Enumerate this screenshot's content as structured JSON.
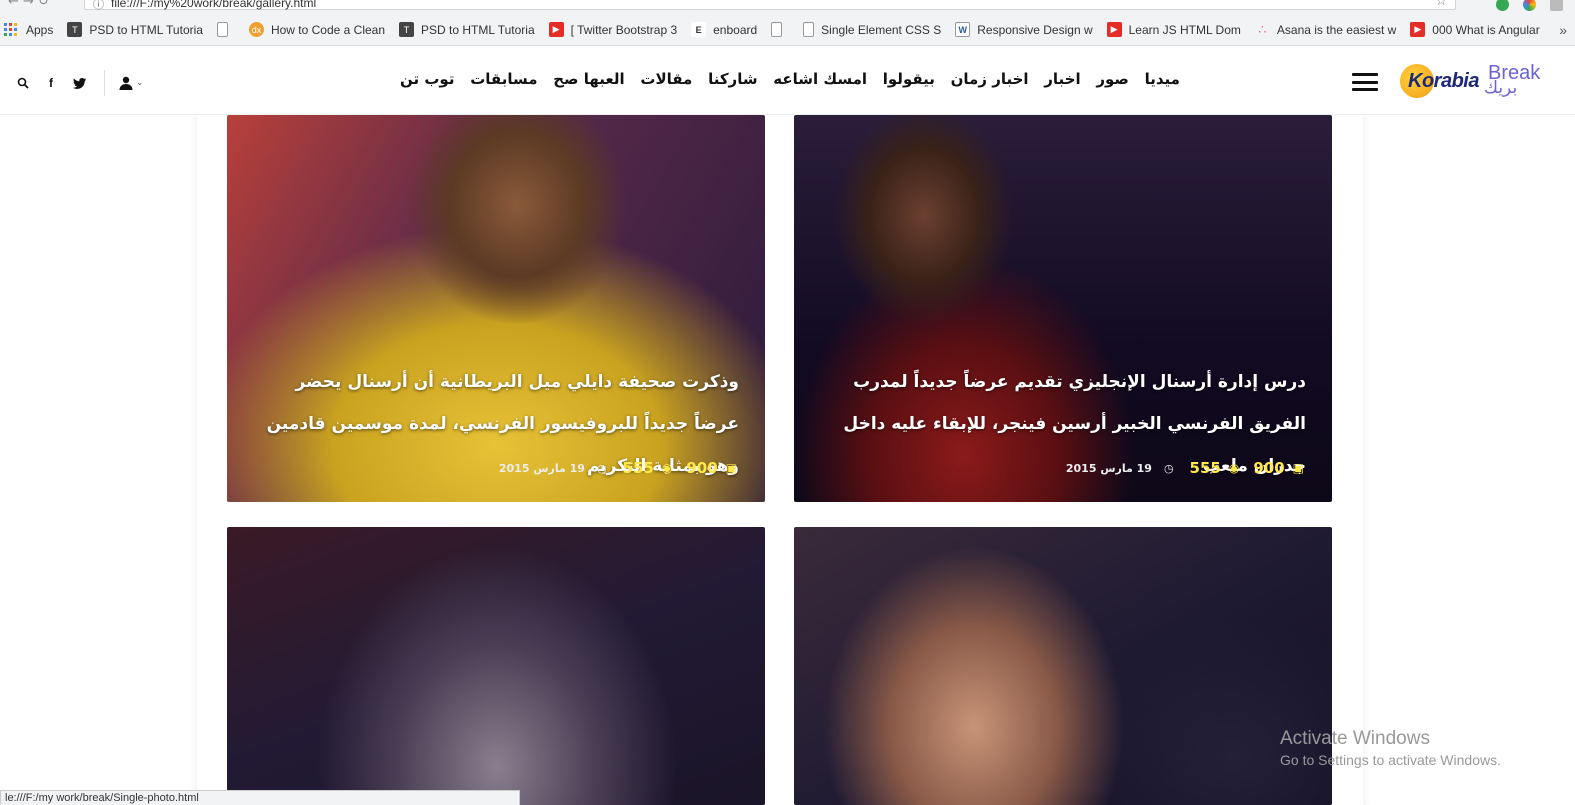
{
  "browser": {
    "url": "file:///F:/my%20work/break/gallery.html",
    "status_url": "le:///F:/my work/break/Single-photo.html",
    "bookmarks": [
      {
        "label": "Apps",
        "icon": "apps-grid-icon",
        "color": "#4285f4"
      },
      {
        "label": "PSD to HTML Tutoria",
        "icon": "tuts-icon",
        "color": "#333333"
      },
      {
        "label": "",
        "icon": "page-icon",
        "color": "#ffffff"
      },
      {
        "label": "How to Code a Clean",
        "icon": "dx-icon",
        "color": "#f0a030"
      },
      {
        "label": "PSD to HTML Tutoria",
        "icon": "tuts-icon",
        "color": "#333333"
      },
      {
        "label": "[ Twitter Bootstrap 3",
        "icon": "youtube-icon",
        "color": "#e52d27"
      },
      {
        "label": "enboard",
        "icon": "e-icon",
        "color": "#555555"
      },
      {
        "label": "",
        "icon": "page-icon",
        "color": "#ffffff"
      },
      {
        "label": "Single Element CSS S",
        "icon": "page-icon",
        "color": "#ffffff"
      },
      {
        "label": "Responsive Design w",
        "icon": "w-icon",
        "color": "#2b579a"
      },
      {
        "label": "Learn JS HTML Dom",
        "icon": "youtube-icon",
        "color": "#e52d27"
      },
      {
        "label": "Asana is the easiest w",
        "icon": "asana-icon",
        "color": "#f06a6a"
      },
      {
        "label": "000 What is Angular",
        "icon": "youtube-icon",
        "color": "#e52d27"
      }
    ]
  },
  "header": {
    "logo_text": "Korabia",
    "logo_break": "Break",
    "logo_arabic": "بريك",
    "nav": [
      "ميديا",
      "صور",
      "اخبار",
      "اخبار زمان",
      "بيقولوا",
      "امسك اشاعه",
      "شاركنا",
      "مقالات",
      "العبها صح",
      "مسابقات",
      "توب تن"
    ],
    "icons": [
      "search-icon",
      "facebook-icon",
      "twitter-icon",
      "user-icon"
    ]
  },
  "cards": [
    {
      "title": "درس إدارة أرسنال الإنجليزي تقديم عرضاً جديداً لمدرب الفريق الفرنسي الخبير أرسين فينجر، للإبقاء عليه داخل جدران ملعب",
      "photos": "900",
      "views": "555",
      "date": "19 مارس 2015",
      "tint": "#1a0f2e"
    },
    {
      "title": "وذكرت صحيفة دايلي ميل البريطانية أن أرسنال يحضر عرضاً جديداً للبروفيسور الفرنسي، لمدة موسمين قادمين وهو بمثابة التكريم",
      "photos": "900",
      "views": "555",
      "date": "19 مارس 2015",
      "tint": "#d9b634"
    },
    {
      "title": "",
      "tint": "#2a1f35"
    },
    {
      "title": "",
      "tint": "#1a1530"
    }
  ],
  "watermark": {
    "line1": "Activate Windows",
    "line2": "Go to Settings to activate Windows."
  }
}
